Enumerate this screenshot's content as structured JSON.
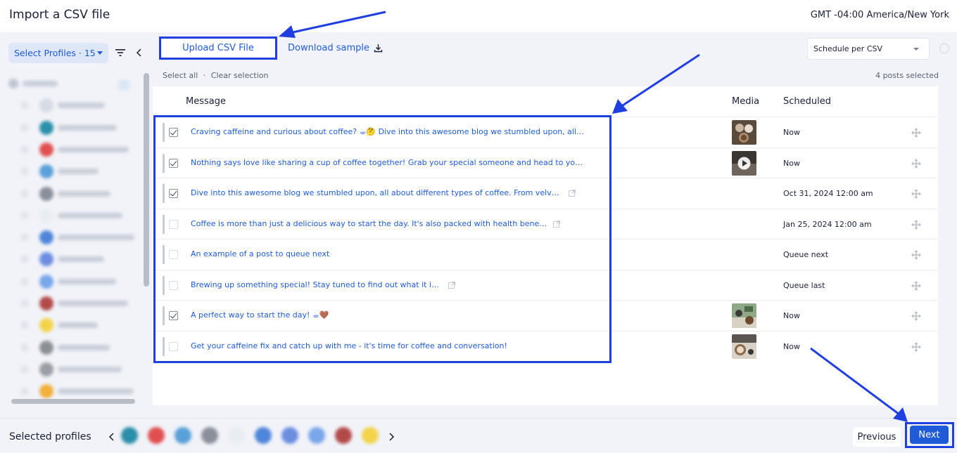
{
  "header": {
    "title": "Import a CSV file",
    "timezone": "GMT -04:00 America/New York"
  },
  "sidebar": {
    "profile_select_label": "Select Profiles · 15",
    "profiles_blurred": [
      {
        "color": "#bfc6d4"
      },
      {
        "color": "#d7dbe3"
      },
      {
        "color": "#2a8fa8"
      },
      {
        "color": "#e05050"
      },
      {
        "color": "#5aa0d8"
      },
      {
        "color": "#8a8f9a"
      },
      {
        "color": "#e9ecf1"
      },
      {
        "color": "#4f86d9"
      },
      {
        "color": "#6d8de0"
      },
      {
        "color": "#7aa6ea"
      },
      {
        "color": "#b34a4a"
      },
      {
        "color": "#f3d34a"
      },
      {
        "color": "#8c8f94"
      },
      {
        "color": "#9a9da3"
      },
      {
        "color": "#f0b03a"
      }
    ]
  },
  "toolbar": {
    "upload_label": "Upload CSV File",
    "download_label": "Download sample",
    "schedule_mode": "Schedule per CSV"
  },
  "selection": {
    "select_all": "Select all",
    "separator": "·",
    "clear": "Clear selection",
    "count": "4 posts selected"
  },
  "table": {
    "columns": {
      "message": "Message",
      "media": "Media",
      "scheduled": "Scheduled"
    },
    "rows": [
      {
        "checked": true,
        "message": "Craving caffeine and curious about coffee? ☕🤔 Dive into this awesome blog we stumbled upon, all ab...",
        "link": false,
        "media": "coffee-cups",
        "scheduled": "Now"
      },
      {
        "checked": true,
        "message": "Nothing says love like sharing a cup of coffee together! Grab your special someone and head to your ...",
        "link": false,
        "media": "video",
        "scheduled": "Now"
      },
      {
        "checked": true,
        "message": "Dive into this awesome blog we stumbled upon, all about different types of coffee. From velvety latt...",
        "link": true,
        "media": "",
        "scheduled": "Oct 31, 2024 12:00 am"
      },
      {
        "checked": false,
        "message": "Coffee is more than just a delicious way to start the day. It's also packed with health benefits. St...",
        "link": true,
        "media": "",
        "scheduled": "Jan 25, 2024 12:00 am"
      },
      {
        "checked": false,
        "message": "An example of a post to queue next",
        "link": false,
        "media": "",
        "scheduled": "Queue next"
      },
      {
        "checked": false,
        "message": "Brewing up something special! Stay tuned to find out what it is! ☕🤎",
        "link": true,
        "media": "",
        "scheduled": "Queue last"
      },
      {
        "checked": true,
        "message": "A perfect way to start the day! ☕🤎",
        "link": false,
        "media": "cafe",
        "scheduled": "Now"
      },
      {
        "checked": false,
        "message": "Get your caffeine fix and catch up with me - it's time for coffee and conversation!",
        "link": false,
        "media": "latte",
        "scheduled": "Now"
      }
    ]
  },
  "footer": {
    "selected_profiles_label": "Selected profiles",
    "previous_label": "Previous",
    "next_label": "Next",
    "avatars_blurred": [
      "#2a8fa8",
      "#e05050",
      "#5aa0d8",
      "#8a8f9a",
      "#e9ecf1",
      "#4f86d9",
      "#6d8de0",
      "#7aa6ea",
      "#b34a4a",
      "#f3d34a"
    ]
  },
  "colors": {
    "accent": "#1f5bd6",
    "annotation": "#1f3fe0"
  }
}
